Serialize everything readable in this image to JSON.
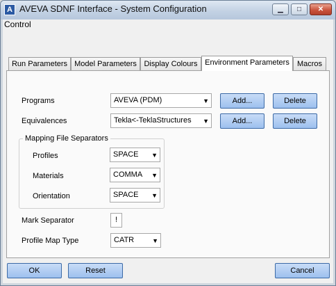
{
  "window": {
    "title": "AVEVA SDNF Interface - System Configuration",
    "app_icon_glyph": "A",
    "controls": {
      "minimize": "▁",
      "maximize": "□",
      "close": "✕"
    }
  },
  "menu": {
    "control": "Control"
  },
  "tabs": [
    {
      "label": "Run Parameters",
      "active": false
    },
    {
      "label": "Model Parameters",
      "active": false
    },
    {
      "label": "Display Colours",
      "active": false
    },
    {
      "label": "Environment Parameters",
      "active": true
    },
    {
      "label": "Macros",
      "active": false
    }
  ],
  "env": {
    "programs_label": "Programs",
    "programs_value": "AVEVA (PDM)",
    "equivalences_label": "Equivalences",
    "equivalences_value": "Tekla<-TeklaStructures",
    "add_label": "Add...",
    "delete_label": "Delete",
    "mapping_group_title": "Mapping File Separators",
    "profiles_label": "Profiles",
    "profiles_value": "SPACE",
    "materials_label": "Materials",
    "materials_value": "COMMA",
    "orientation_label": "Orientation",
    "orientation_value": "SPACE",
    "mark_separator_label": "Mark Separator",
    "mark_separator_value": "!",
    "profile_map_type_label": "Profile Map Type",
    "profile_map_type_value": "CATR"
  },
  "footer": {
    "ok": "OK",
    "reset": "Reset",
    "cancel": "Cancel"
  },
  "icons": {
    "dropdown": "▼"
  }
}
